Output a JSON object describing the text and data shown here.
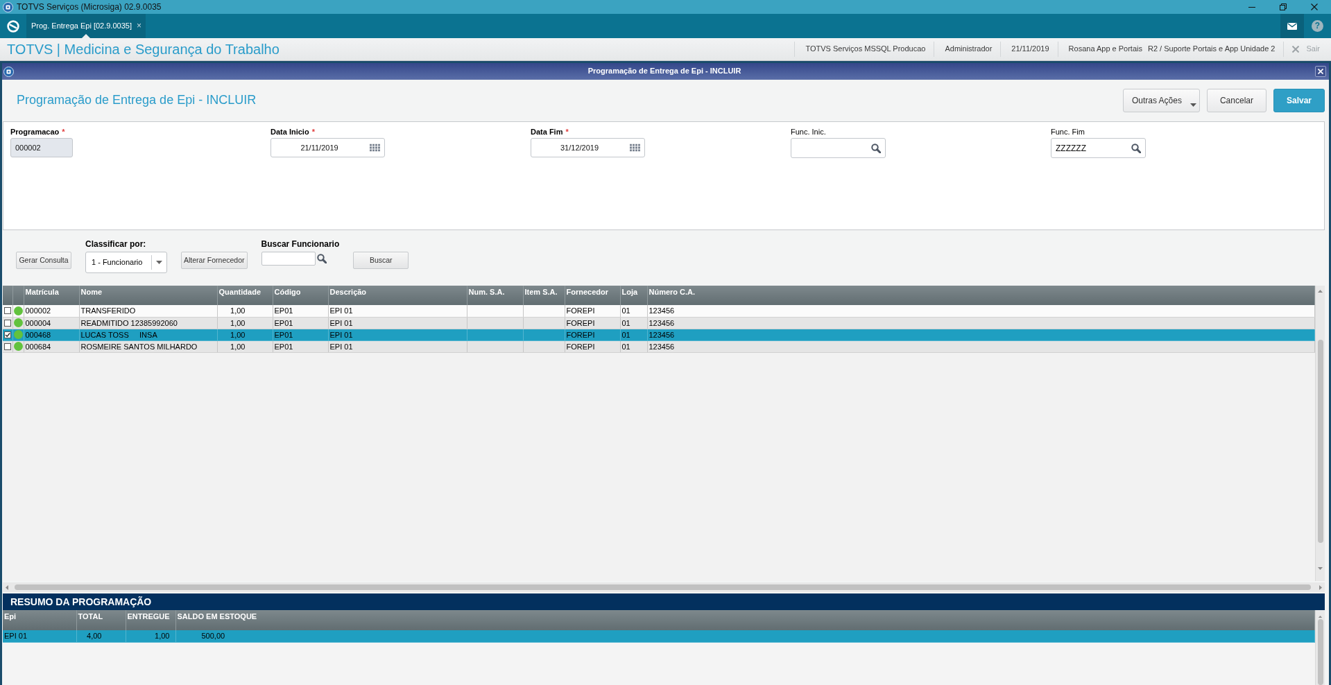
{
  "window": {
    "title": "TOTVS Serviços (Microsiga) 02.9.0035"
  },
  "tabs": [
    {
      "label": "Prog. Entrega Epi [02.9.0035]",
      "close": "×",
      "selected": true
    }
  ],
  "topbar": {
    "help": "?"
  },
  "header": {
    "title": "TOTVS | Medicina e Segurança do Trabalho",
    "info": [
      [
        "TOTVS Serviços MSSQL Producao"
      ],
      [
        "Administrador"
      ],
      [
        "21/11/2019"
      ],
      [
        "Rosana App e Portais",
        "R2 / Suporte Portais e App Unidade 2"
      ]
    ],
    "exit": {
      "label": "Sair",
      "disabled": true
    }
  },
  "dialog": {
    "title": "Programação de Entrega de Epi - INCLUIR",
    "heading": "Programação de Entrega de Epi - INCLUIR",
    "actions": [
      {
        "label": "Outras Ações",
        "kind": "menu"
      },
      {
        "label": "Cancelar",
        "kind": "secondary"
      },
      {
        "label": "Salvar",
        "kind": "primary"
      }
    ]
  },
  "form": {
    "fields": [
      {
        "label": "Programacao",
        "required": true,
        "required_mark": "*",
        "kind": "text",
        "value": "000002",
        "disabled": true
      },
      {
        "label": "Data Inicio",
        "required": true,
        "required_mark": "*",
        "kind": "date",
        "value": "21/11/2019",
        "disabled": false
      },
      {
        "label": "Data Fim",
        "required": true,
        "required_mark": "*",
        "kind": "date",
        "value": "31/12/2019",
        "disabled": false
      },
      {
        "label": "Func. Inic.",
        "required": false,
        "kind": "lookup",
        "disabled": false
      },
      {
        "label": "Func. Fim",
        "required": false,
        "kind": "lookup",
        "value": "ZZZZZZ",
        "disabled": false
      }
    ]
  },
  "toolbar": {
    "items": [
      {
        "kind": "button",
        "label": "Gerar Consulta"
      },
      {
        "kind": "select",
        "label": "Classificar por:",
        "value": "1 - Funcionario"
      },
      {
        "kind": "button",
        "label": "Alterar Fornecedor"
      },
      {
        "kind": "search",
        "label": "Buscar Funcionario"
      },
      {
        "kind": "button",
        "label": "Buscar"
      }
    ]
  },
  "grid": {
    "columns": [
      "Matrícula",
      "Nome",
      "Quantidade",
      "Código",
      "Descrição",
      "Num. S.A.",
      "Item S.A.",
      "Fornecedor",
      "Loja",
      "Número C.A."
    ],
    "rows": [
      {
        "checked": false,
        "selected": false,
        "color": "#62c23e",
        "cells": [
          "000002",
          "TRANSFERIDO",
          "1,00",
          "EP01",
          "EPI 01",
          null,
          null,
          "FOREPI",
          "01",
          "123456"
        ]
      },
      {
        "checked": false,
        "selected": false,
        "color": "#62c23e",
        "cells": [
          "000004",
          "READMITIDO 12385992060",
          "1,00",
          "EP01",
          "EPI 01",
          null,
          null,
          "FOREPI",
          "01",
          "123456"
        ]
      },
      {
        "checked": true,
        "selected": true,
        "color": "#62c23e",
        "cells": [
          "000468",
          "LUCAS TOSS     INSA",
          "1,00",
          "EP01",
          "EPI 01",
          null,
          null,
          "FOREPI",
          "01",
          "123456"
        ]
      },
      {
        "checked": false,
        "selected": false,
        "color": "#62c23e",
        "cells": [
          "000684",
          "ROSMEIRE SANTOS MILHARDO",
          "1,00",
          "EP01",
          "EPI 01",
          null,
          null,
          "FOREPI",
          "01",
          "123456"
        ]
      }
    ]
  },
  "summary": {
    "title": "RESUMO DA PROGRAMAÇÃO",
    "columns": [
      "Epi",
      "TOTAL",
      "ENTREGUE",
      "SALDO EM ESTOQUE"
    ],
    "rows": [
      {
        "selected": true,
        "cells": [
          "EPI 01",
          "4,00",
          "1,00",
          "500,00"
        ]
      }
    ]
  }
}
